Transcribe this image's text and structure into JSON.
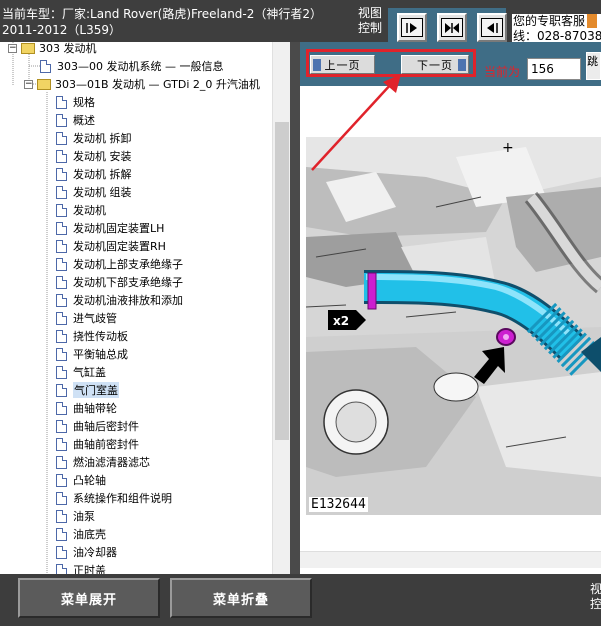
{
  "header": {
    "vehicle_line1": "当前车型：厂家:Land Rover(路虎)Freeland-2（神行者2）",
    "vehicle_line2": "2011-2012（L359）",
    "view_control_label": "视图控制",
    "service_line1": "您的专职客服",
    "service_line2": "线：028-87038"
  },
  "tree": {
    "root_label": "303 发动机",
    "items": [
      {
        "label": "303—00 发动机系统 — 一般信息",
        "type": "doc",
        "level": 1
      },
      {
        "label": "303—01B 发动机 — GTDi 2_0 升汽油机",
        "type": "folder",
        "level": 1
      },
      {
        "label": "规格",
        "type": "doc",
        "level": 2
      },
      {
        "label": "概述",
        "type": "doc",
        "level": 2
      },
      {
        "label": "发动机 拆卸",
        "type": "doc",
        "level": 2
      },
      {
        "label": "发动机 安装",
        "type": "doc",
        "level": 2
      },
      {
        "label": "发动机 拆解",
        "type": "doc",
        "level": 2
      },
      {
        "label": "发动机 组装",
        "type": "doc",
        "level": 2
      },
      {
        "label": "发动机",
        "type": "doc",
        "level": 2
      },
      {
        "label": "发动机固定装置LH",
        "type": "doc",
        "level": 2
      },
      {
        "label": "发动机固定装置RH",
        "type": "doc",
        "level": 2
      },
      {
        "label": "发动机上部支承绝缘子",
        "type": "doc",
        "level": 2
      },
      {
        "label": "发动机下部支承绝缘子",
        "type": "doc",
        "level": 2
      },
      {
        "label": "发动机油液排放和添加",
        "type": "doc",
        "level": 2
      },
      {
        "label": "进气歧管",
        "type": "doc",
        "level": 2
      },
      {
        "label": "挠性传动板",
        "type": "doc",
        "level": 2
      },
      {
        "label": "平衡轴总成",
        "type": "doc",
        "level": 2
      },
      {
        "label": "气缸盖",
        "type": "doc",
        "level": 2
      },
      {
        "label": "气门室盖",
        "type": "doc",
        "level": 2,
        "selected": true
      },
      {
        "label": "曲轴带轮",
        "type": "doc",
        "level": 2
      },
      {
        "label": "曲轴后密封件",
        "type": "doc",
        "level": 2
      },
      {
        "label": "曲轴前密封件",
        "type": "doc",
        "level": 2
      },
      {
        "label": "燃油滤清器滤芯",
        "type": "doc",
        "level": 2
      },
      {
        "label": "凸轮轴",
        "type": "doc",
        "level": 2
      },
      {
        "label": "系统操作和组件说明",
        "type": "doc",
        "level": 2
      },
      {
        "label": "油泵",
        "type": "doc",
        "level": 2
      },
      {
        "label": "油底壳",
        "type": "doc",
        "level": 2
      },
      {
        "label": "油冷却器",
        "type": "doc",
        "level": 2
      },
      {
        "label": "正时盖",
        "type": "doc",
        "level": 2
      }
    ]
  },
  "nav": {
    "prev_label": "上一页",
    "next_label": "下一页",
    "current_label": "当前为",
    "page_value": "156",
    "go_label": "跳"
  },
  "document": {
    "figure_id": "E132644",
    "callout_label": "x2"
  },
  "bottom": {
    "expand_label": "菜单展开",
    "collapse_label": "菜单折叠",
    "view_control_label": "视控"
  },
  "colors": {
    "toolbar": "#3d3d3d",
    "nav_blue": "#3f6d86",
    "highlight_red": "#e0232b",
    "hose_cyan": "#21c0e8",
    "clip_magenta": "#cc1fd0"
  }
}
